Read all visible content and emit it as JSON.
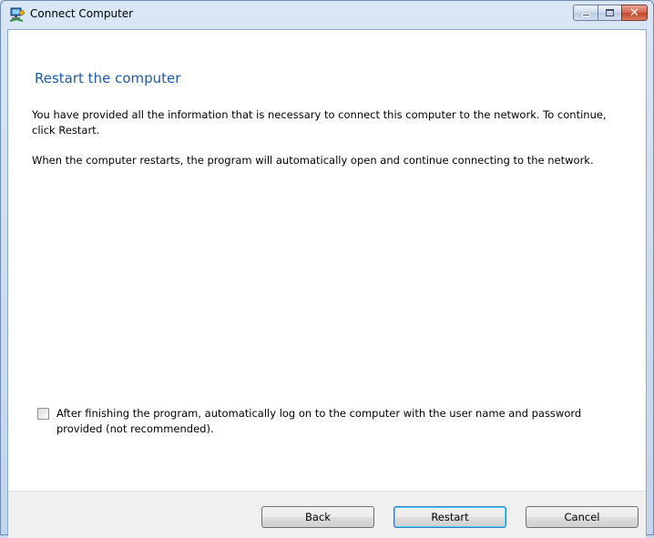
{
  "window": {
    "title": "Connect Computer"
  },
  "content": {
    "heading": "Restart the computer",
    "paragraph1": "You have provided all the information that is necessary to connect this computer to the network. To continue, click Restart.",
    "paragraph2": "When the computer restarts, the program will automatically open and continue connecting to the network."
  },
  "options": {
    "auto_logon_label": "After finishing the program, automatically log on to the computer with the user name and password provided (not recommended).",
    "auto_logon_checked": false
  },
  "footer": {
    "back_label": "Back",
    "restart_label": "Restart",
    "cancel_label": "Cancel"
  },
  "icons": {
    "app": "network-computer-icon",
    "minimize": "minimize-icon",
    "maximize": "maximize-icon",
    "close": "close-icon"
  },
  "colors": {
    "heading": "#1e5aa8",
    "close_button": "#c2462b"
  }
}
